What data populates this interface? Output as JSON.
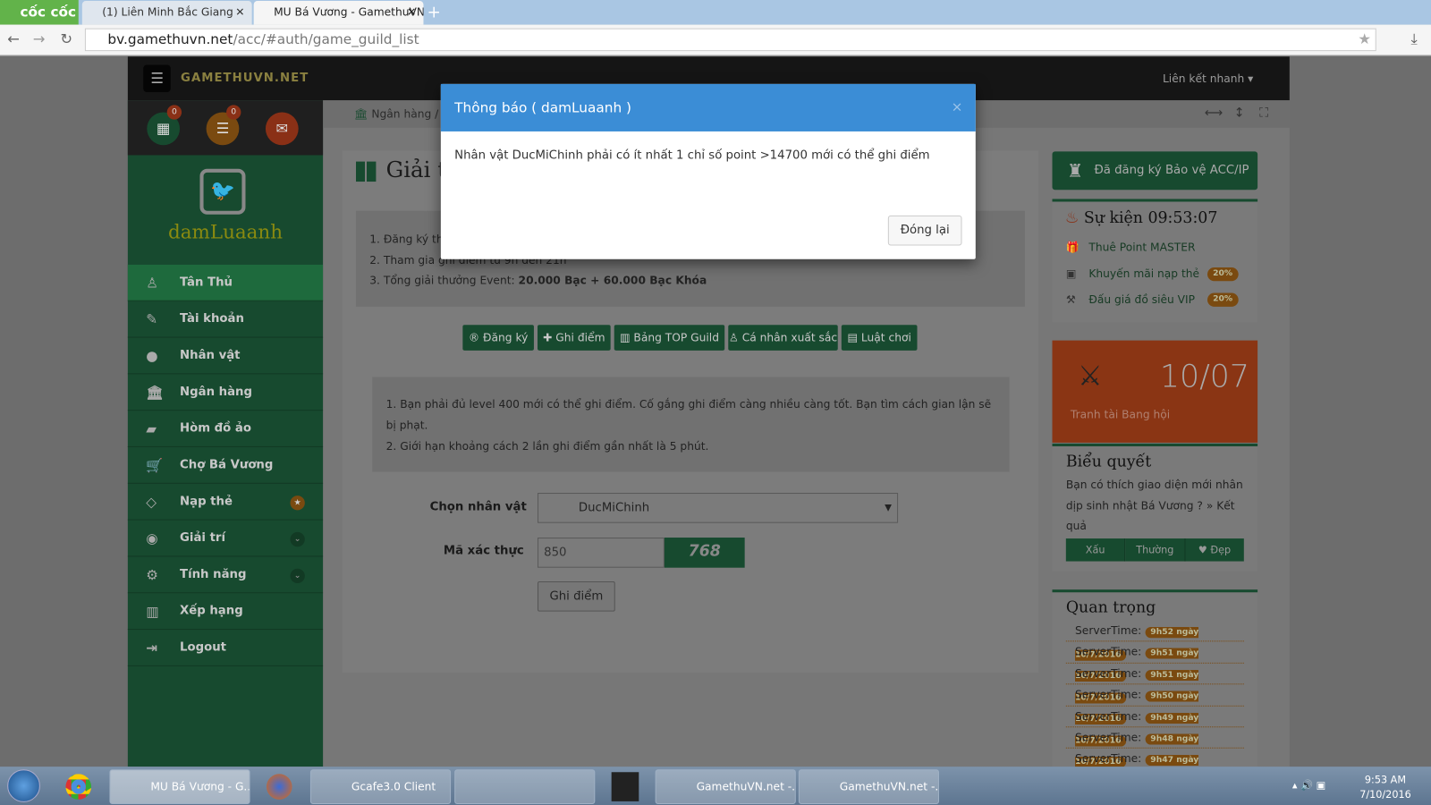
{
  "browser": {
    "brand": "cốc cốc",
    "tabs": [
      {
        "label": "(1) Liên Minh Bắc Giang",
        "active": false
      },
      {
        "label": "MU Bá Vương - GamethuVN",
        "active": true
      }
    ],
    "url_host": "bv.gamethuvn.net",
    "url_path": "/acc/#auth/game_guild_list"
  },
  "header": {
    "logo": "GAMETHUVN.NET",
    "quick_links": "Liên kết nhanh"
  },
  "sidebar": {
    "badges": [
      "0",
      "0"
    ],
    "username": "damLuaanh",
    "items": [
      {
        "label": "Tân Thủ",
        "icon": "person-icon"
      },
      {
        "label": "Tài khoản",
        "icon": "edit-icon"
      },
      {
        "label": "Nhân vật",
        "icon": "user-icon"
      },
      {
        "label": "Ngân hàng",
        "icon": "bank-icon"
      },
      {
        "label": "Hòm đồ ảo",
        "icon": "briefcase-icon"
      },
      {
        "label": "Chợ Bá Vương",
        "icon": "cart-icon"
      },
      {
        "label": "Nạp thẻ",
        "icon": "diamond-icon"
      },
      {
        "label": "Giải trí",
        "icon": "android-icon"
      },
      {
        "label": "Tính năng",
        "icon": "gears-icon"
      },
      {
        "label": "Xếp hạng",
        "icon": "chart-icon"
      },
      {
        "label": "Logout",
        "icon": "logout-icon"
      }
    ]
  },
  "breadcrumb": {
    "item": "Ngân hàng",
    "sep": "/"
  },
  "main": {
    "title": "Giải trí",
    "rules": [
      "1. Đăng ký tha",
      "2. Tham gia ghi điểm từ 9h đến 21h",
      "3. Tổng giải thưởng Event: "
    ],
    "reward": "20.000 Bạc + 60.000 Bạc Khóa",
    "buttons": [
      "Đăng ký",
      "Ghi điểm",
      "Bảng TOP Guild",
      "Cá nhân xuất sắc",
      "Luật chơi"
    ],
    "notes": [
      "1. Bạn phải đủ level 400 mới có thể ghi điểm. Cố gắng ghi điểm càng nhiều càng tốt. Bạn tìm cách gian lận sẽ bị phạt.",
      "2. Giới hạn khoảng cách 2 lần ghi điểm gần nhất là 5 phút."
    ],
    "character_label": "Chọn nhân vật",
    "character_value": "DucMiChinh",
    "captcha_label": "Mã xác thực",
    "captcha_value": "850",
    "captcha_image": "768",
    "submit": "Ghi điểm"
  },
  "right": {
    "protect": "Đã đăng ký Bảo vệ ACC/IP",
    "event_title": "Sự kiện 09:53:07",
    "events": [
      {
        "label": "Thuê Point MASTER",
        "badge": ""
      },
      {
        "label": "Khuyến mãi nạp thẻ",
        "badge": "20%"
      },
      {
        "label": "Đấu giá đồ siêu VIP",
        "badge": "20%"
      }
    ],
    "promo_date": "10/07",
    "promo_label": "Tranh tài Bang hội",
    "poll_title": "Biểu quyết",
    "poll_text": "Bạn có thích giao diện mới nhân dịp sinh nhật Bá Vương ? » Kết quả",
    "poll_options": [
      "Xấu",
      "Thường",
      "♥ Đẹp"
    ],
    "important_title": "Quan trọng",
    "server_label": "ServerTime:",
    "server_times": [
      "9h52 ngày 10/7/2016",
      "9h51 ngày 10/7/2016",
      "9h51 ngày 10/7/2016",
      "9h50 ngày 10/7/2016",
      "9h49 ngày 10/7/2016",
      "9h48 ngày 10/7/2016",
      "9h47 ngày 10/7/2016"
    ]
  },
  "modal": {
    "title": "Thông báo ( damLuaanh )",
    "message": "Nhân vật DucMiChinh phải có ít nhất 1 chỉ số point >14700 mới có thể ghi điểm",
    "close_button": "Đóng lại"
  },
  "taskbar": {
    "items": [
      "MU Bá Vương - G...",
      "Gcafe3.0 Client",
      "GamethuVN.net -...",
      "GamethuVN.net -..."
    ],
    "time": "9:53 AM",
    "date": "7/10/2016"
  },
  "colors": {
    "accent_green": "#174a2f",
    "modal_header": "#3b8dd6",
    "promo": "#b34a1e",
    "badge": "#7a4a10"
  }
}
